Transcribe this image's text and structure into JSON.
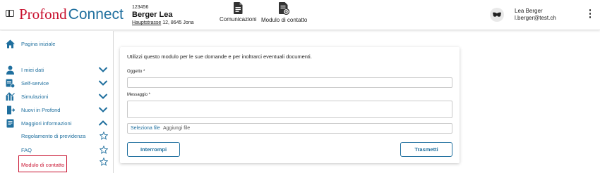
{
  "brand": {
    "part1": "Profond",
    "part2": "Connect"
  },
  "client": {
    "number": "123456",
    "name": "Berger Lea",
    "street": "Hauptstrasse",
    "address_rest": " 12, 8645 Jona"
  },
  "top_nav": [
    {
      "label": "Comunicazioni",
      "icon": "document-icon"
    },
    {
      "label": "Modulo di contatto",
      "icon": "contact-form-icon"
    }
  ],
  "user": {
    "name": "Lea Berger",
    "email": "l.berger@test.ch",
    "avatar_icon": "mask-icon"
  },
  "sidebar": {
    "items": [
      {
        "label": "Pagina iniziale",
        "icon": "home-icon"
      },
      {
        "label": "I miei dati",
        "icon": "person-icon",
        "chevron": "down"
      },
      {
        "label": "Self-service",
        "icon": "self-service-icon",
        "chevron": "down"
      },
      {
        "label": "Simulazioni",
        "icon": "simulation-icon",
        "chevron": "down"
      },
      {
        "label": "Nuovi in Profond",
        "icon": "door-enter-icon",
        "chevron": "down"
      },
      {
        "label": "Maggiori informazioni",
        "icon": "info-doc-icon",
        "chevron": "up"
      }
    ],
    "subitems": [
      {
        "label": "Regolamento di previdenza"
      },
      {
        "label": "FAQ"
      },
      {
        "label": "Modulo di contatto",
        "active": true
      }
    ]
  },
  "form": {
    "intro": "Utilizzi questo modulo per le sue domande e per inoltrarci eventuali documenti.",
    "subject_label": "Oggetto *",
    "subject_value": "",
    "message_label": "Messaggio *",
    "message_value": "",
    "file_select": "Seleziona file",
    "file_placeholder": "Aggiungi file",
    "cancel_label": "Interrompi",
    "submit_label": "Trasmetti"
  },
  "colors": {
    "brand_red": "#c8102e",
    "accent_blue": "#1f6f9e"
  }
}
